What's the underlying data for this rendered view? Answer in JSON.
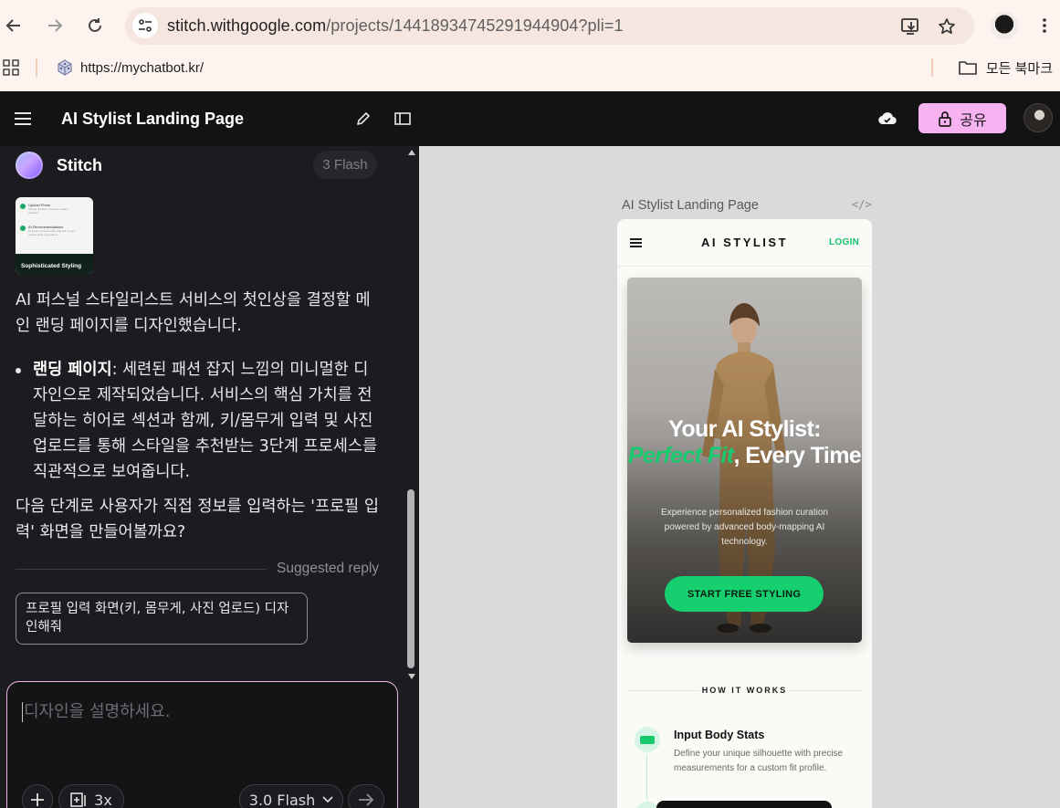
{
  "browser": {
    "url_host": "stitch.withgoogle.com",
    "url_path": "/projects/14418934745291944904?pli=1",
    "bookmark_item": "https://mychatbot.kr/",
    "all_bookmarks": "모든 북마크"
  },
  "header": {
    "title": "AI Stylist Landing Page",
    "share_label": "공유"
  },
  "chat": {
    "agent_name": "Stitch",
    "model_badge": "3 Flash",
    "thumbnail": {
      "row1_title": "Upload Photo",
      "row1_text": "Simply upload a photo for instant analysis",
      "row2_title": "AI Recommendations",
      "row2_text": "Receive curated outfits tailored to your unique body proportions",
      "footer": "Sophisticated Styling"
    },
    "intro": "AI 퍼스널 스타일리스트 서비스의 첫인상을 결정할 메인 랜딩 페이지를 디자인했습니다.",
    "bullets": [
      {
        "bold": "랜딩 페이지",
        "text": ": 세련된 패션 잡지 느낌의 미니멀한 디자인으로 제작되었습니다. 서비스의 핵심 가치를 전달하는 히어로 섹션과 함께, 키/몸무게 입력 및 사진 업로드를 통해 스타일을 추천받는 3단계 프로세스를 직관적으로 보여줍니다."
      }
    ],
    "next_step": "다음 단계로 사용자가 직접 정보를 입력하는 '프로필 입력' 화면을 만들어볼까요?",
    "suggested_label": "Suggested reply",
    "suggested_reply": "프로필 입력 화면(키, 몸무게, 사진 업로드) 디자인해줘",
    "composer_placeholder": "디자인을 설명하세요.",
    "variants_label": "3x",
    "model_select": "3.0 Flash"
  },
  "canvas": {
    "frame_label": "AI Stylist Landing Page",
    "phone": {
      "brand": "AI STYLIST",
      "login": "LOGIN",
      "hero_title_1": "Your AI Stylist:",
      "hero_title_accent": "Perfect Fit",
      "hero_title_2": ", Every Time",
      "hero_subtitle": "Experience personalized fashion curation powered by advanced body-mapping AI technology.",
      "cta": "START FREE STYLING",
      "how_title": "HOW IT WORKS",
      "step1_title": "Input Body Stats",
      "step1_desc": "Define your unique silhouette with precise measurements for a custom fit profile."
    }
  },
  "colors": {
    "accent_green": "#16d06f",
    "share_pink": "#f7b3f1",
    "panel_dark": "#1c1c20"
  }
}
